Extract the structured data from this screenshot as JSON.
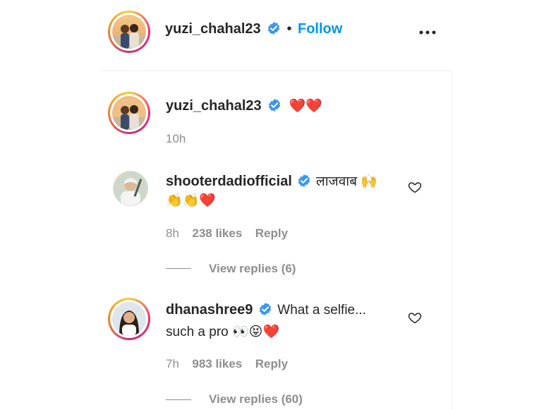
{
  "header": {
    "username": "yuzi_chahal23",
    "separator": "•",
    "follow_label": "Follow",
    "more_icon": "more-options-icon"
  },
  "caption": {
    "username": "yuzi_chahal23",
    "text_emoji": "❤️❤️",
    "time": "10h"
  },
  "comments": [
    {
      "username": "shooterdadiofficial",
      "text_line1": "लाजवाब 🙌",
      "text_line2": "👏👏❤️",
      "time": "8h",
      "likes": "238 likes",
      "reply_label": "Reply",
      "view_replies": "View replies (6)"
    },
    {
      "username": "dhanashree9",
      "text_line1": "What a selfie...",
      "text_line2": "such a pro 👀😝❤️",
      "time": "7h",
      "likes": "983 likes",
      "reply_label": "Reply",
      "view_replies": "View replies (60)"
    }
  ],
  "colors": {
    "accent": "#0095f6",
    "verified": "#3897f0",
    "heart": "#ed4956",
    "muted": "#8e8e8e"
  }
}
